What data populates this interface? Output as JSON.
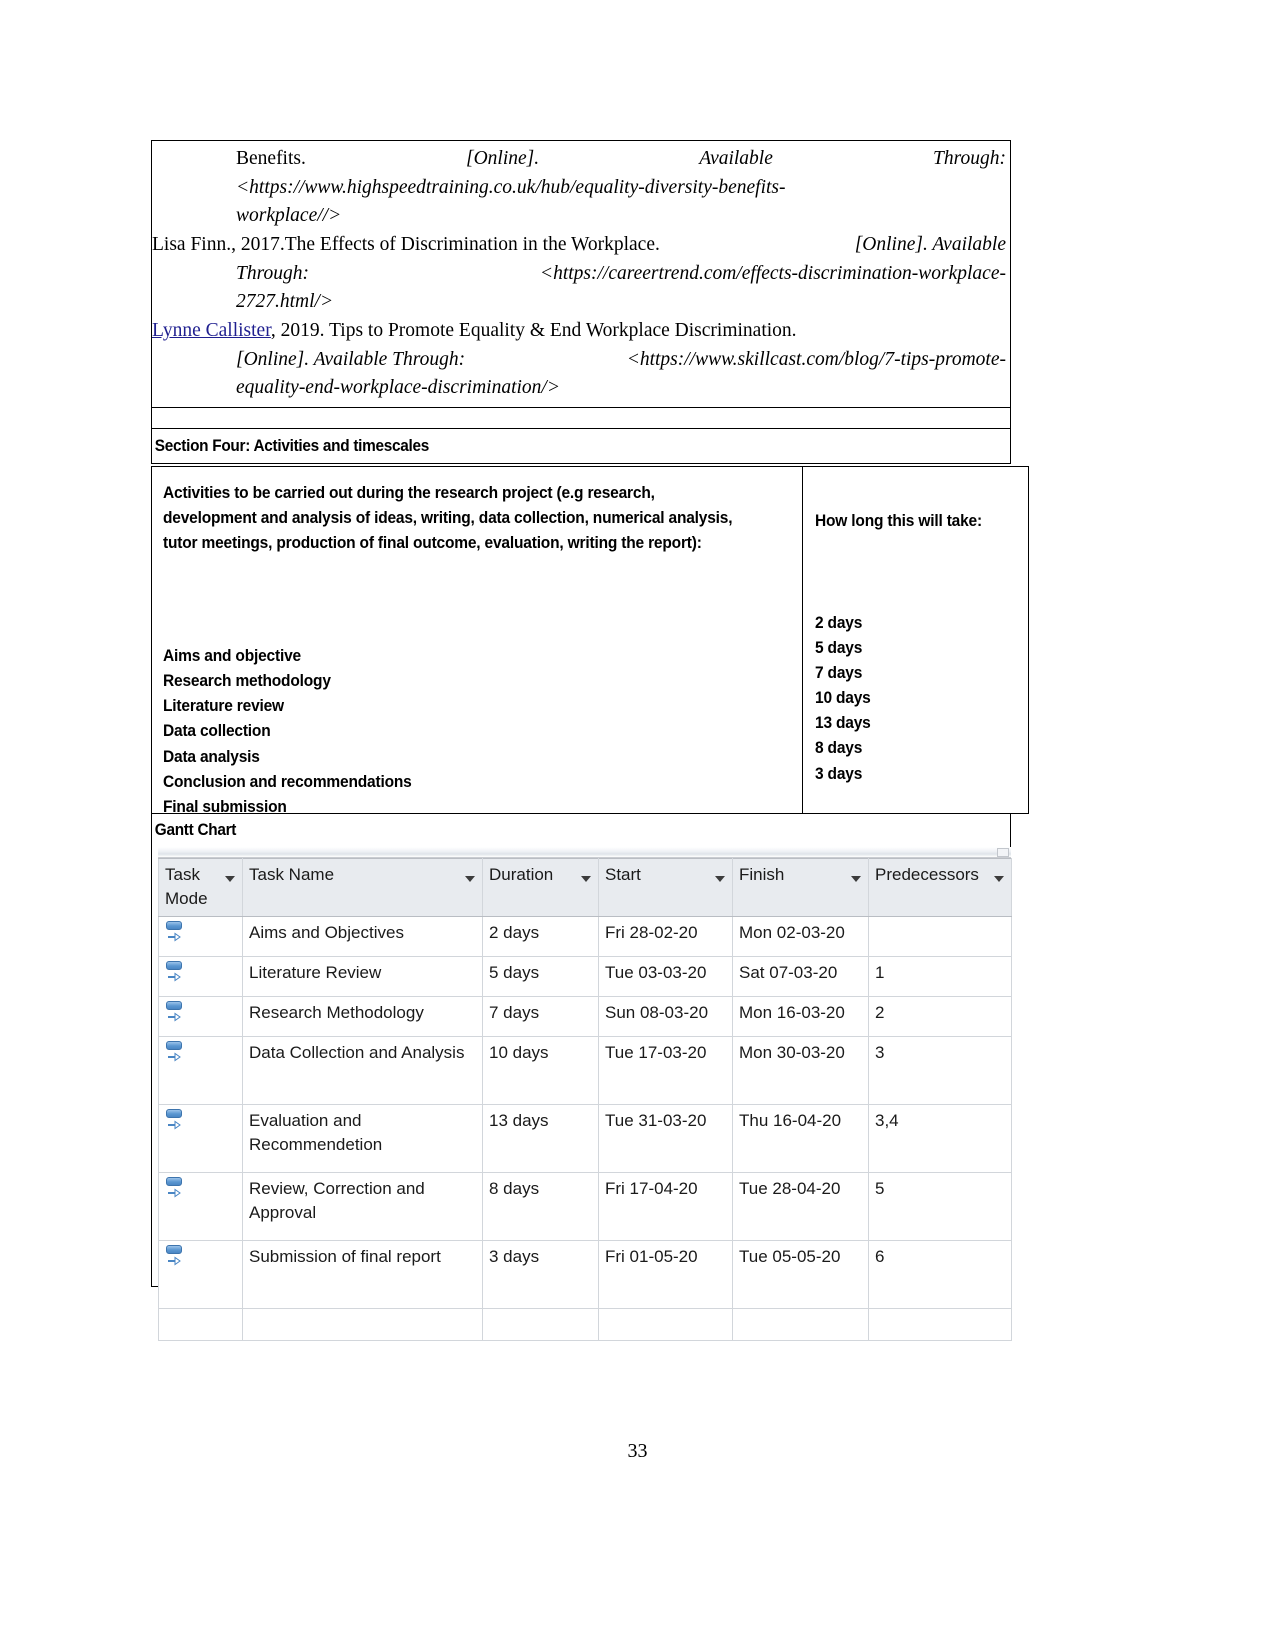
{
  "document": {
    "page_number": "33"
  },
  "references": {
    "entries": [
      {
        "lead_plain": "Benefits.",
        "lead_italic_1": "[Online].",
        "lead_italic_2": "Available",
        "lead_italic_3": "Through:",
        "url_line_1": "<https://www.highspeedtraining.co.uk/hub/equality-diversity-benefits-",
        "url_line_2": "workplace//>"
      },
      {
        "plain_1": "Lisa Finn., 2017.The Effects of Discrimination in the Workplace.",
        "italic_1": "[Online]. Available",
        "italic_2": "Through:",
        "url_line_1": "<https://careertrend.com/effects-discrimination-workplace-",
        "url_line_2": "2727.html/>"
      },
      {
        "link_text": "Lynne Callister",
        "plain_1": ", 2019. Tips to Promote Equality & End Workplace Discrimination.",
        "italic_1": "[Online]. Available Through:",
        "italic_2": "<https://www.skillcast.com/blog/7-tips-promote-",
        "italic_3": "equality-end-workplace-discrimination/>"
      }
    ]
  },
  "section_four": {
    "heading": "Section Four: Activities and timescales"
  },
  "activities_table": {
    "left_header": "Activities to be carried out during the research project (e.g research, development and analysis of ideas, writing, data collection, numerical analysis, tutor meetings, production of final outcome, evaluation, writing the report):",
    "right_header": "How long this will take:",
    "rows": [
      {
        "activity": "Aims and objective",
        "duration": "2 days"
      },
      {
        "activity": "Research methodology",
        "duration": "5 days"
      },
      {
        "activity": "Literature review",
        "duration": "7 days"
      },
      {
        "activity": "Data collection",
        "duration": "10 days"
      },
      {
        "activity": "Data analysis",
        "duration": "13 days"
      },
      {
        "activity": "Conclusion and recommendations",
        "duration": "8 days"
      },
      {
        "activity": "Final submission",
        "duration": "3 days"
      }
    ]
  },
  "gantt_section": {
    "label": "Gantt Chart",
    "columns": [
      {
        "label": "Task Mode",
        "key": "mode",
        "highlight": "none"
      },
      {
        "label": "Task Name",
        "key": "name",
        "highlight": "none"
      },
      {
        "label": "Duration",
        "key": "duration",
        "highlight": "none"
      },
      {
        "label": "Start",
        "key": "start",
        "highlight": "yellow"
      },
      {
        "label": "Finish",
        "key": "finish",
        "highlight": "none"
      },
      {
        "label": "Predecessors",
        "key": "predecessors",
        "highlight": "yellow"
      }
    ],
    "rows": [
      {
        "mode_icon": "manually-scheduled-icon",
        "name": "Aims and Objectives",
        "duration": "2 days",
        "start": "Fri 28-02-20",
        "finish": "Mon 02-03-20",
        "predecessors": ""
      },
      {
        "mode_icon": "manually-scheduled-icon",
        "name": "Literature Review",
        "duration": "5 days",
        "start": "Tue 03-03-20",
        "finish": "Sat 07-03-20",
        "predecessors": "1"
      },
      {
        "mode_icon": "manually-scheduled-icon",
        "name": "Research Methodology",
        "duration": "7 days",
        "start": "Sun 08-03-20",
        "finish": "Mon 16-03-20",
        "predecessors": "2"
      },
      {
        "mode_icon": "manually-scheduled-icon",
        "name": "Data Collection and Analysis",
        "duration": "10 days",
        "start": "Tue 17-03-20",
        "finish": "Mon 30-03-20",
        "predecessors": "3"
      },
      {
        "mode_icon": "manually-scheduled-icon",
        "name": "Evaluation and Recommendetion",
        "duration": "13 days",
        "start": "Tue 31-03-20",
        "finish": "Thu 16-04-20",
        "predecessors": "3,4"
      },
      {
        "mode_icon": "manually-scheduled-icon",
        "name": "Review, Correction and Approval",
        "duration": "8 days",
        "start": "Fri 17-04-20",
        "finish": "Tue 28-04-20",
        "predecessors": "5"
      },
      {
        "mode_icon": "manually-scheduled-icon",
        "name": "Submission of final report",
        "duration": "3 days",
        "start": "Fri 01-05-20",
        "finish": "Tue 05-05-20",
        "predecessors": "6"
      }
    ],
    "colors": {
      "header_yellow": "#ffd966",
      "header_grey": "#e8ebef",
      "selected_row_blue": "#dce6f1",
      "grid_line": "#d2d6db"
    }
  }
}
